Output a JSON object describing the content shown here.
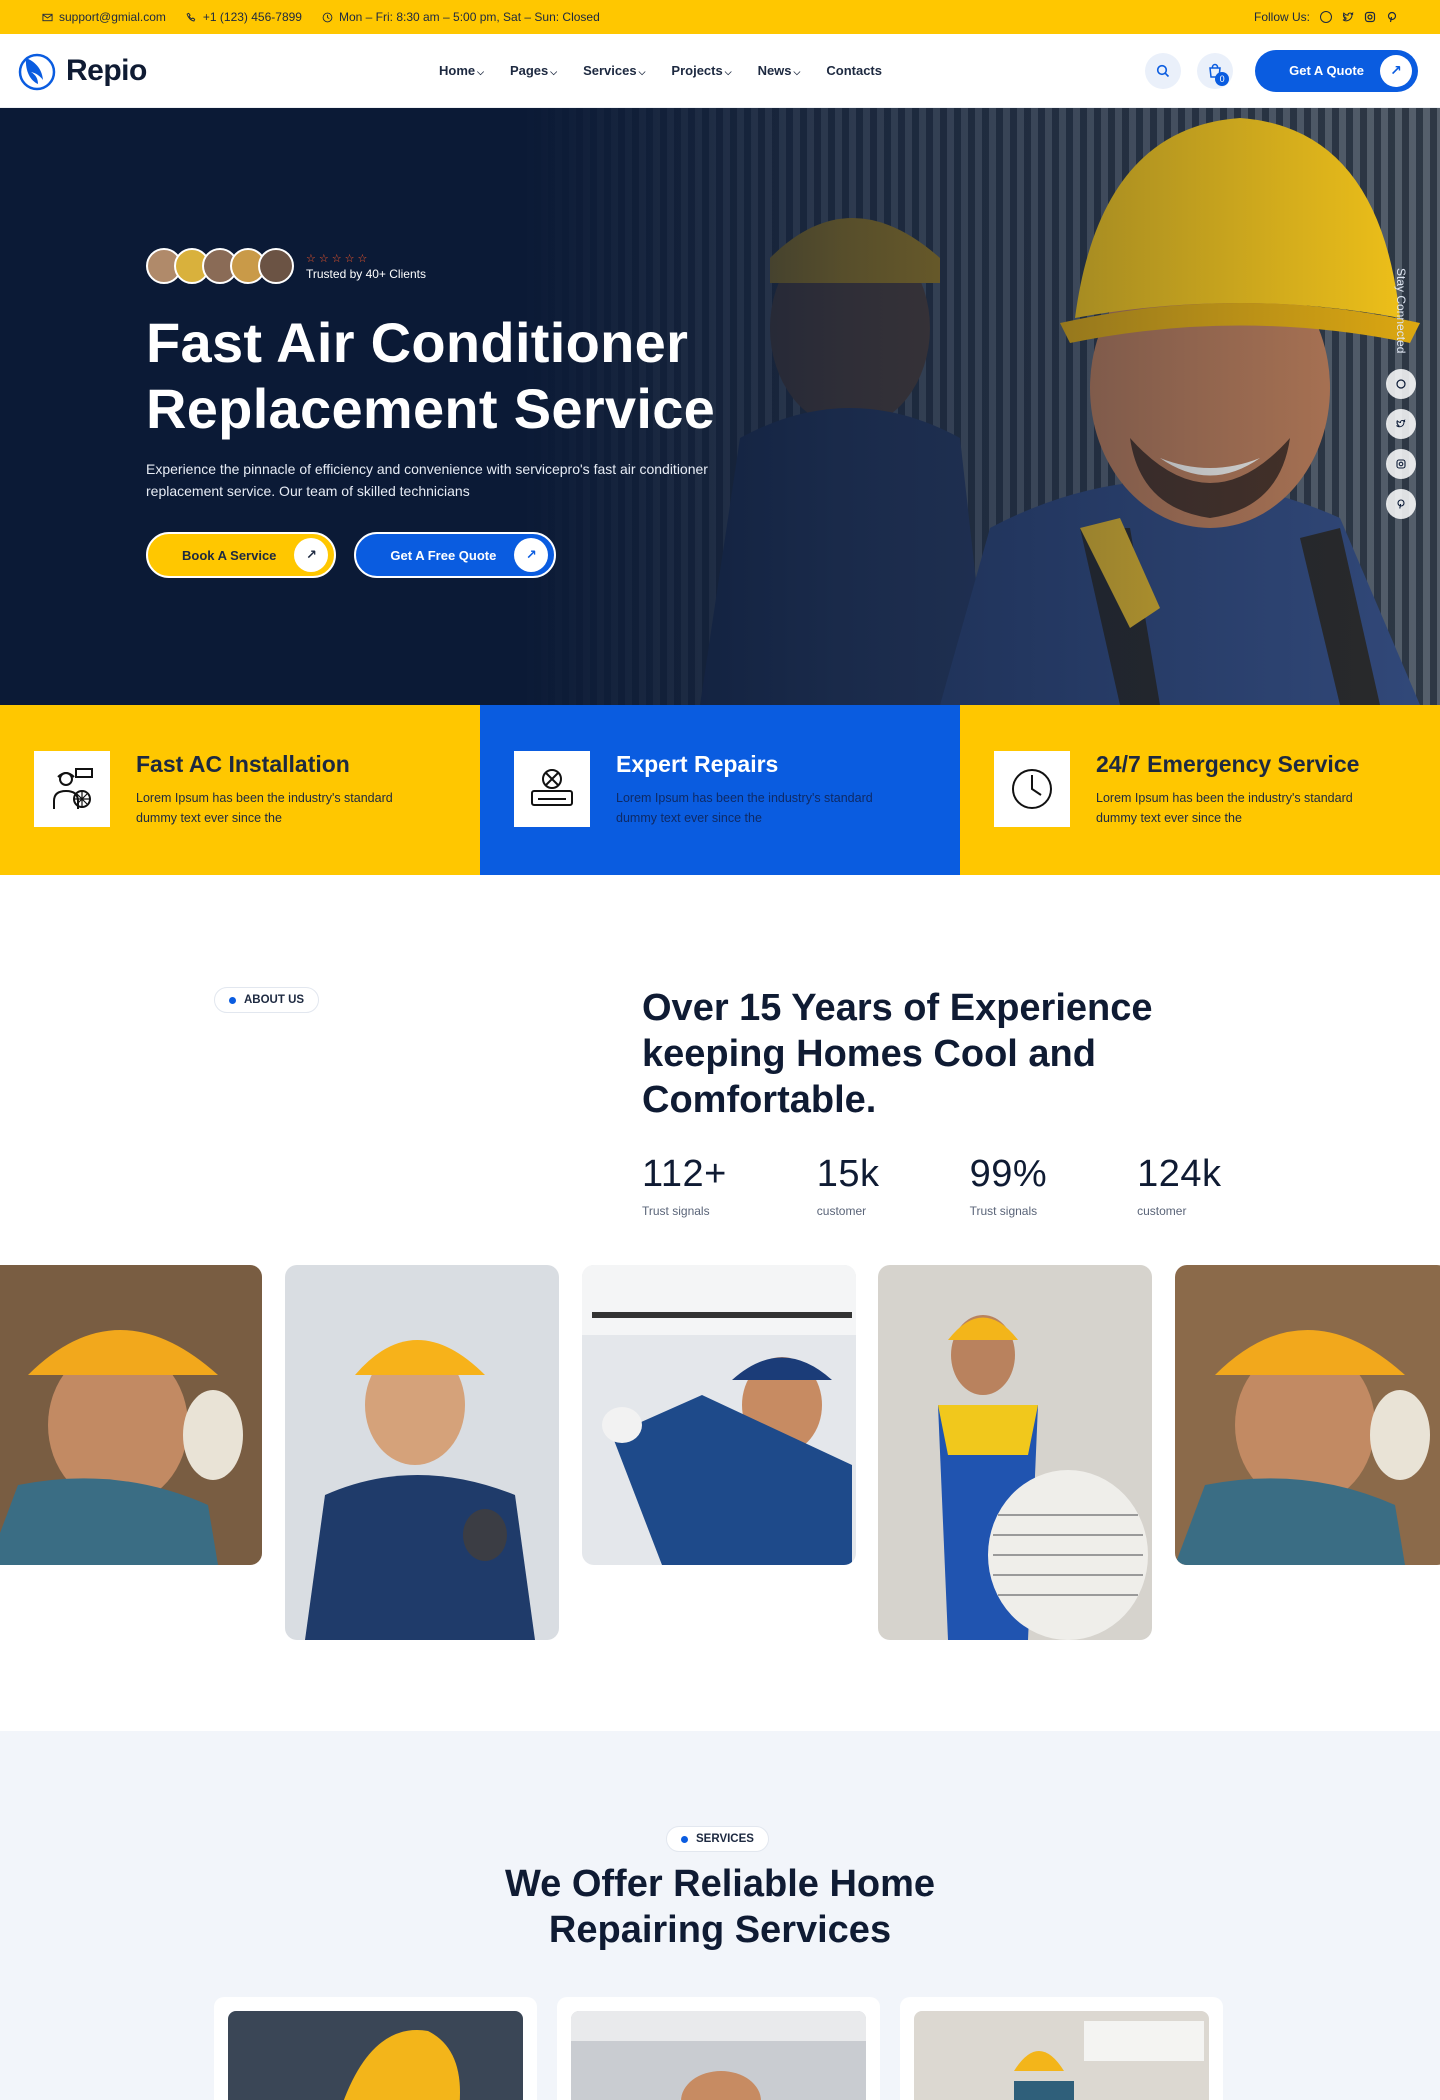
{
  "topbar": {
    "email": "support@gmial.com",
    "phone": "+1 (123) 456-7899",
    "hours": "Mon – Fri: 8:30 am – 5:00 pm, Sat – Sun: Closed",
    "follow_label": "Follow Us:"
  },
  "brand": {
    "name": "Repio",
    "primary": "#0a5ce0",
    "accent": "#ffc700",
    "dark": "#0b1a36"
  },
  "nav": {
    "items": [
      {
        "label": "Home",
        "dropdown": true
      },
      {
        "label": "Pages",
        "dropdown": true
      },
      {
        "label": "Services",
        "dropdown": true
      },
      {
        "label": "Projects",
        "dropdown": true
      },
      {
        "label": "News",
        "dropdown": true
      },
      {
        "label": "Contacts",
        "dropdown": false
      }
    ],
    "cart_count": "0",
    "quote_label": "Get A Quote"
  },
  "hero": {
    "trusted": "Trusted by 40+ Clients",
    "stars": "☆☆☆☆☆",
    "title_line1": "Fast Air Conditioner",
    "title_line2": "Replacement Service",
    "description": "Experience the pinnacle of efficiency and convenience with servicepro's fast air conditioner replacement service. Our team of skilled technicians",
    "btn_book": "Book A Service",
    "btn_quote": "Get A Free Quote",
    "stay_connected": "Stay Connected"
  },
  "features": [
    {
      "title": "Fast AC Installation",
      "text": "Lorem Ipsum has been the industry's standard dummy text ever since the",
      "icon": "technician-icon"
    },
    {
      "title": "Expert Repairs",
      "text": "Lorem Ipsum has been the industry's standard dummy text ever since the",
      "icon": "ac-repair-icon"
    },
    {
      "title": "24/7 Emergency Service",
      "text": "Lorem Ipsum has been the industry's standard dummy text ever since the",
      "icon": "clock-icon"
    }
  ],
  "about": {
    "tag": "ABOUT US",
    "title": "Over 15 Years of Experience keeping Homes Cool and Comfortable.",
    "stats": [
      {
        "value": "112+",
        "label": "Trust signals"
      },
      {
        "value": "15k",
        "label": "customer"
      },
      {
        "value": "99%",
        "label": "Trust signals"
      },
      {
        "value": "124k",
        "label": "customer"
      }
    ]
  },
  "services": {
    "tag": "SERVICES",
    "title_line1": "We Offer Reliable Home",
    "title_line2": "Repairing Services"
  }
}
